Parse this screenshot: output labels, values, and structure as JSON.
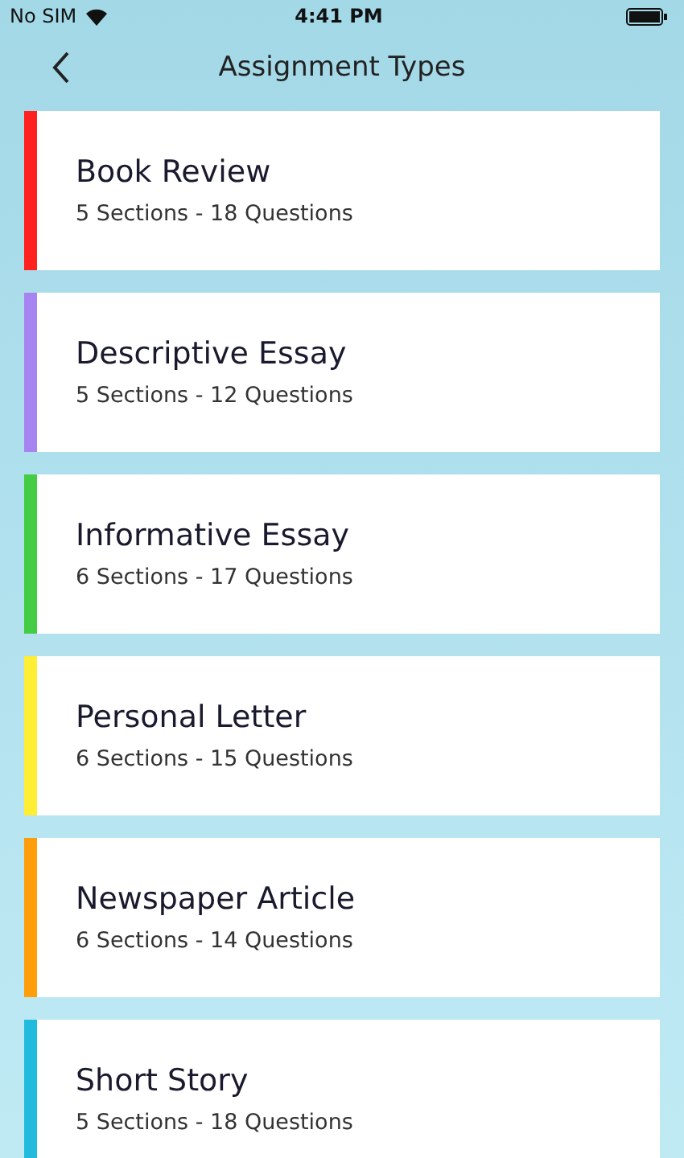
{
  "status_bar": {
    "carrier": "No SIM",
    "time": "4:41 PM"
  },
  "nav": {
    "title": "Assignment Types"
  },
  "items": [
    {
      "title": "Book Review",
      "subtitle": "5 Sections - 18 Questions",
      "color": "#ff2020"
    },
    {
      "title": "Descriptive Essay",
      "subtitle": "5 Sections - 12 Questions",
      "color": "#a685f0"
    },
    {
      "title": "Informative Essay",
      "subtitle": "6 Sections - 17 Questions",
      "color": "#44cc44"
    },
    {
      "title": "Personal Letter",
      "subtitle": "6 Sections - 15 Questions",
      "color": "#ffee33"
    },
    {
      "title": "Newspaper Article",
      "subtitle": "6 Sections - 14 Questions",
      "color": "#ff9d0a"
    },
    {
      "title": "Short Story",
      "subtitle": "5 Sections - 18 Questions",
      "color": "#22bbdd"
    }
  ]
}
